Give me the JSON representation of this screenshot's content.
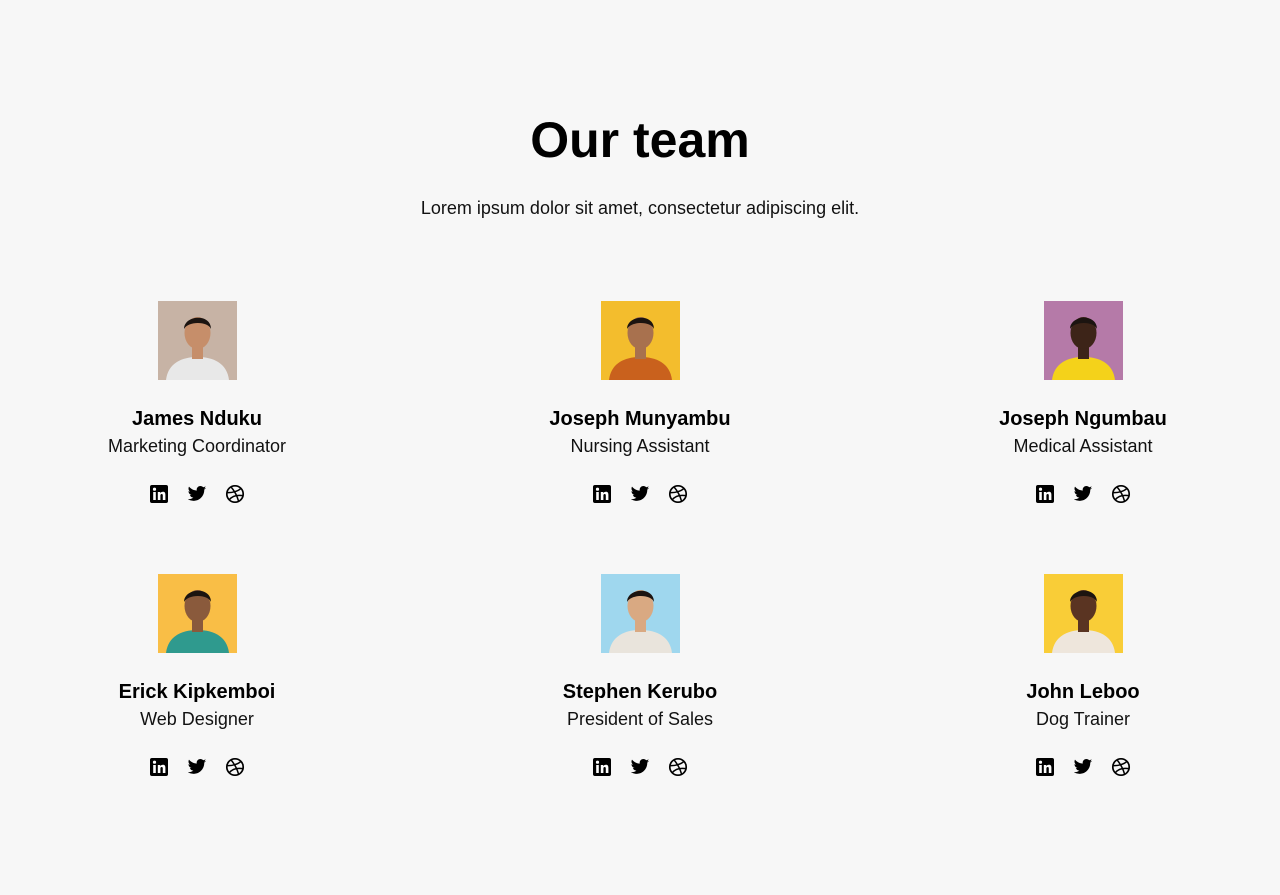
{
  "header": {
    "title": "Our team",
    "subtitle": "Lorem ipsum dolor sit amet, consectetur adipiscing elit."
  },
  "team": [
    {
      "name": "James Nduku",
      "role": "Marketing Coordinator",
      "photo_bg": "#c7b3a5",
      "shirt": "#e8e8e8"
    },
    {
      "name": "Joseph Munyambu",
      "role": "Nursing Assistant",
      "photo_bg": "#f3bd2d",
      "shirt": "#c9611d"
    },
    {
      "name": "Joseph Ngumbau",
      "role": "Medical Assistant",
      "photo_bg": "#b57aa8",
      "shirt": "#f4d21a"
    },
    {
      "name": "Erick Kipkemboi",
      "role": "Web Designer",
      "photo_bg": "#f9be46",
      "shirt": "#2f9a8e"
    },
    {
      "name": "Stephen Kerubo",
      "role": "President of Sales",
      "photo_bg": "#9fd7ee",
      "shirt": "#e9e4dc"
    },
    {
      "name": "John Leboo",
      "role": "Dog Trainer",
      "photo_bg": "#f9cd37",
      "shirt": "#eee6dc"
    }
  ],
  "social_icons": [
    "linkedin-icon",
    "twitter-icon",
    "dribbble-icon"
  ]
}
